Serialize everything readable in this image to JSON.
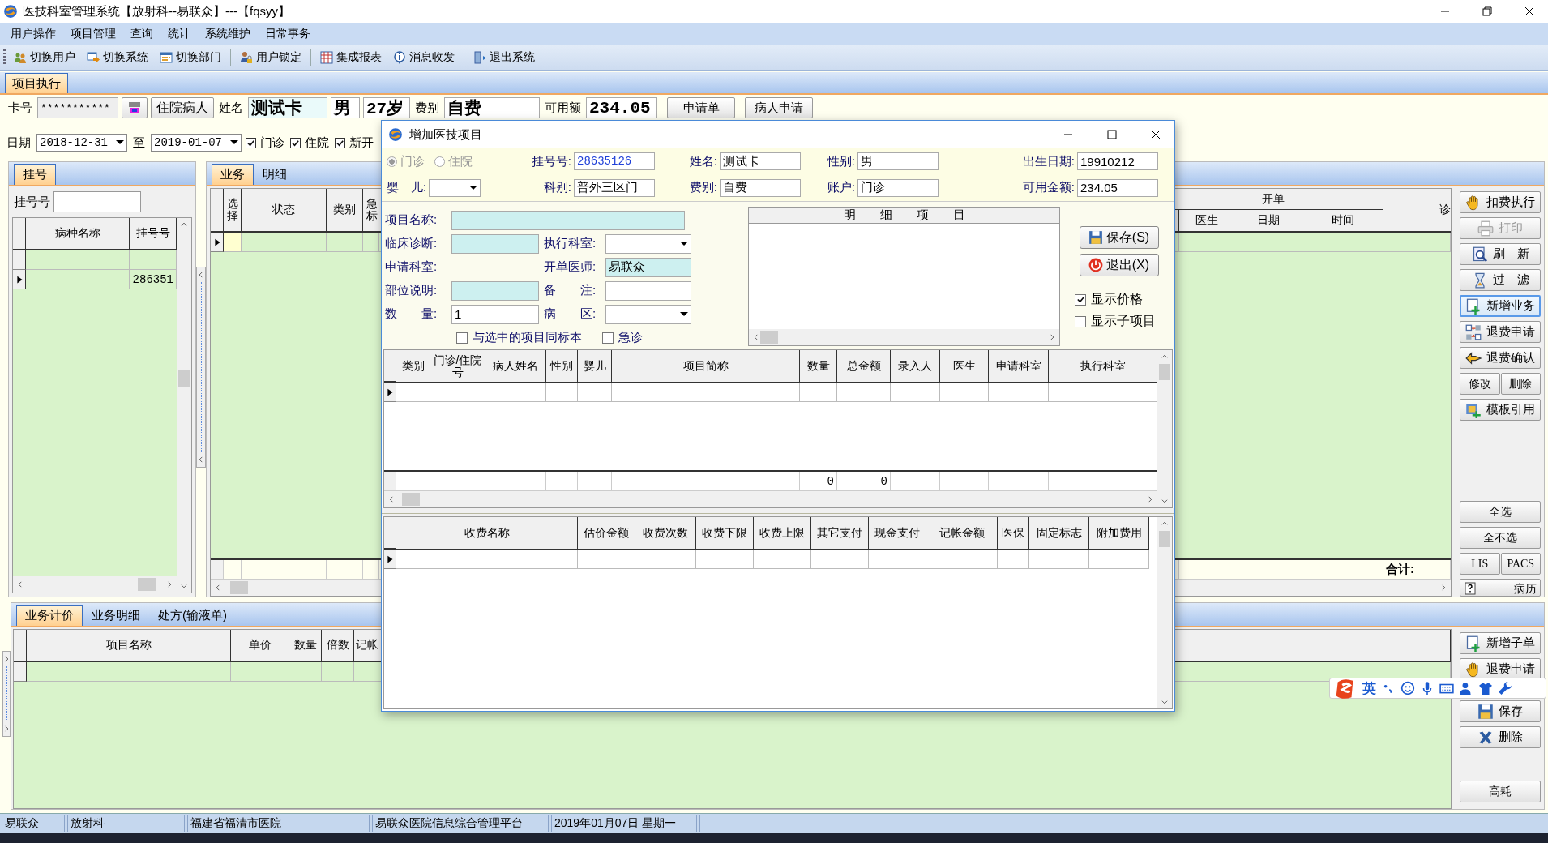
{
  "window": {
    "title": "医技科室管理系统【放射科--易联众】---【fqsyy】"
  },
  "menu": [
    {
      "label": "用户操作"
    },
    {
      "label": "项目管理"
    },
    {
      "label": "查询"
    },
    {
      "label": "统计"
    },
    {
      "label": "系统维护"
    },
    {
      "label": "日常事务"
    }
  ],
  "toolbar": [
    {
      "label": "切换用户",
      "kind": "users",
      "separated": false
    },
    {
      "label": "切换系统",
      "kind": "switch",
      "separated": false
    },
    {
      "label": "切换部门",
      "kind": "calendar",
      "separated": false
    },
    {
      "label": "用户锁定",
      "kind": "lock",
      "separated": true
    },
    {
      "label": "集成报表",
      "kind": "report",
      "separated": true
    },
    {
      "label": "消息收发",
      "kind": "info",
      "separated": false
    },
    {
      "label": "退出系统",
      "kind": "exit",
      "separated": true
    }
  ],
  "module_tabs": [
    {
      "label": "项目执行",
      "selected": true
    }
  ],
  "patient_bar": {
    "card_label": "卡号",
    "card_number": "***********",
    "inpatient_button": "住院病人",
    "name_label": "姓名",
    "name": "测试卡",
    "sex": "男",
    "age": "27岁",
    "fee_type_label": "费别",
    "fee_type": "自费",
    "balance_label": "可用额",
    "balance": "234.05",
    "buttons": [
      "申请单",
      "病人申请"
    ]
  },
  "date_filter": {
    "label": "日期",
    "from": "2018-12-31",
    "to_label": "至",
    "to": "2019-01-07",
    "options": [
      {
        "label": "门诊",
        "checked": true
      },
      {
        "label": "住院",
        "checked": true
      },
      {
        "label": "新开",
        "checked": true
      }
    ]
  },
  "registration_panel": {
    "tabs": [
      {
        "label": "挂号",
        "selected": true
      }
    ],
    "search_label": "挂号号",
    "table": {
      "columns": [
        "病种名称",
        "挂号号"
      ],
      "rows": [
        {
          "cells": [
            "",
            ""
          ],
          "current": false
        },
        {
          "cells": [
            "",
            "286351"
          ],
          "current": true
        }
      ]
    }
  },
  "business_panel": {
    "tabs": [
      {
        "label": "业务",
        "selected": true
      },
      {
        "label": "明细",
        "selected": false
      }
    ],
    "table": {
      "columns": [
        "选择",
        "状态",
        "类别",
        "急标"
      ],
      "group_header": "开单",
      "group_columns": [
        "医生",
        "日期",
        "时间"
      ],
      "column_6": "诊",
      "total_label": "合计:",
      "current_row": true
    }
  },
  "side_buttons": [
    {
      "label": "扣费执行",
      "kind": "hand",
      "disabled": false,
      "focused": false
    },
    {
      "label": "打印",
      "kind": "print",
      "disabled": true,
      "focused": false
    },
    {
      "label": "刷　新",
      "kind": "preview",
      "disabled": false,
      "focused": false
    },
    {
      "label": "过　滤",
      "kind": "hourglass",
      "disabled": false,
      "focused": false
    },
    {
      "label": "新增业务",
      "kind": "add",
      "disabled": false,
      "focused": true
    },
    {
      "label": "退费申请",
      "kind": "exchange",
      "disabled": false,
      "focused": false
    },
    {
      "label": "退费确认",
      "kind": "arrow",
      "disabled": false,
      "focused": false
    },
    {
      "label": "修改",
      "kind": "half",
      "disabled": false,
      "focused": false
    },
    {
      "label": "删除",
      "kind": "half",
      "disabled": false,
      "focused": false
    },
    {
      "label": "模板引用",
      "kind": "template",
      "disabled": false,
      "focused": false
    },
    {
      "label": "全选",
      "kind": "plain",
      "disabled": false,
      "focused": false
    },
    {
      "label": "全不选",
      "kind": "plain",
      "disabled": false,
      "focused": false
    },
    {
      "label": "LIS",
      "kind": "half",
      "disabled": false,
      "focused": false
    },
    {
      "label": "PACS",
      "kind": "half",
      "disabled": false,
      "focused": false
    },
    {
      "label": "病历",
      "kind": "help",
      "disabled": false,
      "focused": false
    }
  ],
  "detail_panel": {
    "tabs": [
      {
        "label": "业务计价",
        "selected": true
      },
      {
        "label": "业务明细",
        "selected": false
      },
      {
        "label": "处方(输液单)",
        "selected": false
      }
    ],
    "table": {
      "columns": [
        "项目名称",
        "单价",
        "数量",
        "倍数",
        "记帐"
      ]
    }
  },
  "detail_buttons": [
    {
      "label": "新增子单",
      "kind": "add"
    },
    {
      "label": "退费申请",
      "kind": "hand"
    },
    {
      "label": "保存",
      "kind": "save"
    },
    {
      "label": "删除",
      "kind": "cross"
    },
    {
      "label": "高耗",
      "kind": "plain"
    }
  ],
  "status_bar": [
    "易联众",
    "放射科",
    "福建省福清市医院",
    "易联众医院信息综合管理平台",
    "2019年01月07日  星期一"
  ],
  "ime_bar": {
    "mode": "英"
  },
  "dialog": {
    "title": "增加医技项目",
    "visit_types": [
      {
        "label": "门诊",
        "selected": true,
        "disabled": true
      },
      {
        "label": "住院",
        "selected": false,
        "disabled": true
      }
    ],
    "header_fields": [
      {
        "label": "挂号号:",
        "value": "28635126",
        "kind": "text"
      },
      {
        "label": "姓名:",
        "value": "测试卡",
        "kind": "text"
      },
      {
        "label": "性别:",
        "value": "男",
        "kind": "text"
      },
      {
        "label": "出生日期:",
        "value": "19910212",
        "kind": "text"
      },
      {
        "label": "婴　儿:",
        "kind": "dropdown"
      },
      {
        "label": "科别:",
        "value": "普外三区门",
        "kind": "text"
      },
      {
        "label": "费别:",
        "value": "自费",
        "kind": "text"
      },
      {
        "label": "账户:",
        "value": "门诊",
        "kind": "text"
      },
      {
        "label": "可用金额:",
        "value": "234.05",
        "kind": "text"
      }
    ],
    "form_fields": [
      {
        "label": "项目名称:",
        "kind": "wide",
        "highlighted": true
      },
      {
        "label": "临床诊断:",
        "kind": "text",
        "highlighted": true
      },
      {
        "label": "执行科室:",
        "kind": "dropdown",
        "highlighted": false
      },
      {
        "label": "申请科室:",
        "kind": "label"
      },
      {
        "label": "开单医师:",
        "kind": "text",
        "value": "易联众",
        "highlighted": true
      },
      {
        "label": "部位说明:",
        "kind": "text",
        "highlighted": true
      },
      {
        "label": "备　　注:",
        "kind": "text",
        "highlighted": false
      },
      {
        "label": "数　　量:",
        "kind": "text",
        "value": "1",
        "highlighted": false
      },
      {
        "label": "病　　区:",
        "kind": "dropdown",
        "highlighted": false
      }
    ],
    "form_checks": [
      {
        "label": "与选中的项目同标本",
        "checked": false
      },
      {
        "label": "急诊",
        "checked": false
      }
    ],
    "detail_list_header": "明　　细　　项　　目",
    "buttons": [
      {
        "label": "保存(S)",
        "kind": "save"
      },
      {
        "label": "退出(X)",
        "kind": "power"
      }
    ],
    "options": [
      {
        "label": "显示价格",
        "checked": true
      },
      {
        "label": "显示子项目",
        "checked": false
      }
    ],
    "items_table": {
      "columns": [
        "类别",
        "门诊/住院号",
        "病人姓名",
        "性别",
        "婴儿",
        "项目简称",
        "数量",
        "总金额",
        "录入人",
        "医生",
        "申请科室",
        "执行科室"
      ],
      "current_row": true,
      "totals": {
        "quantity": "0",
        "amount": "0"
      }
    },
    "charges_table": {
      "columns": [
        "收费名称",
        "估价金额",
        "收费次数",
        "收费下限",
        "收费上限",
        "其它支付",
        "现金支付",
        "记帐金额",
        "医保",
        "固定标志",
        "附加费用"
      ],
      "current_row": true
    }
  }
}
